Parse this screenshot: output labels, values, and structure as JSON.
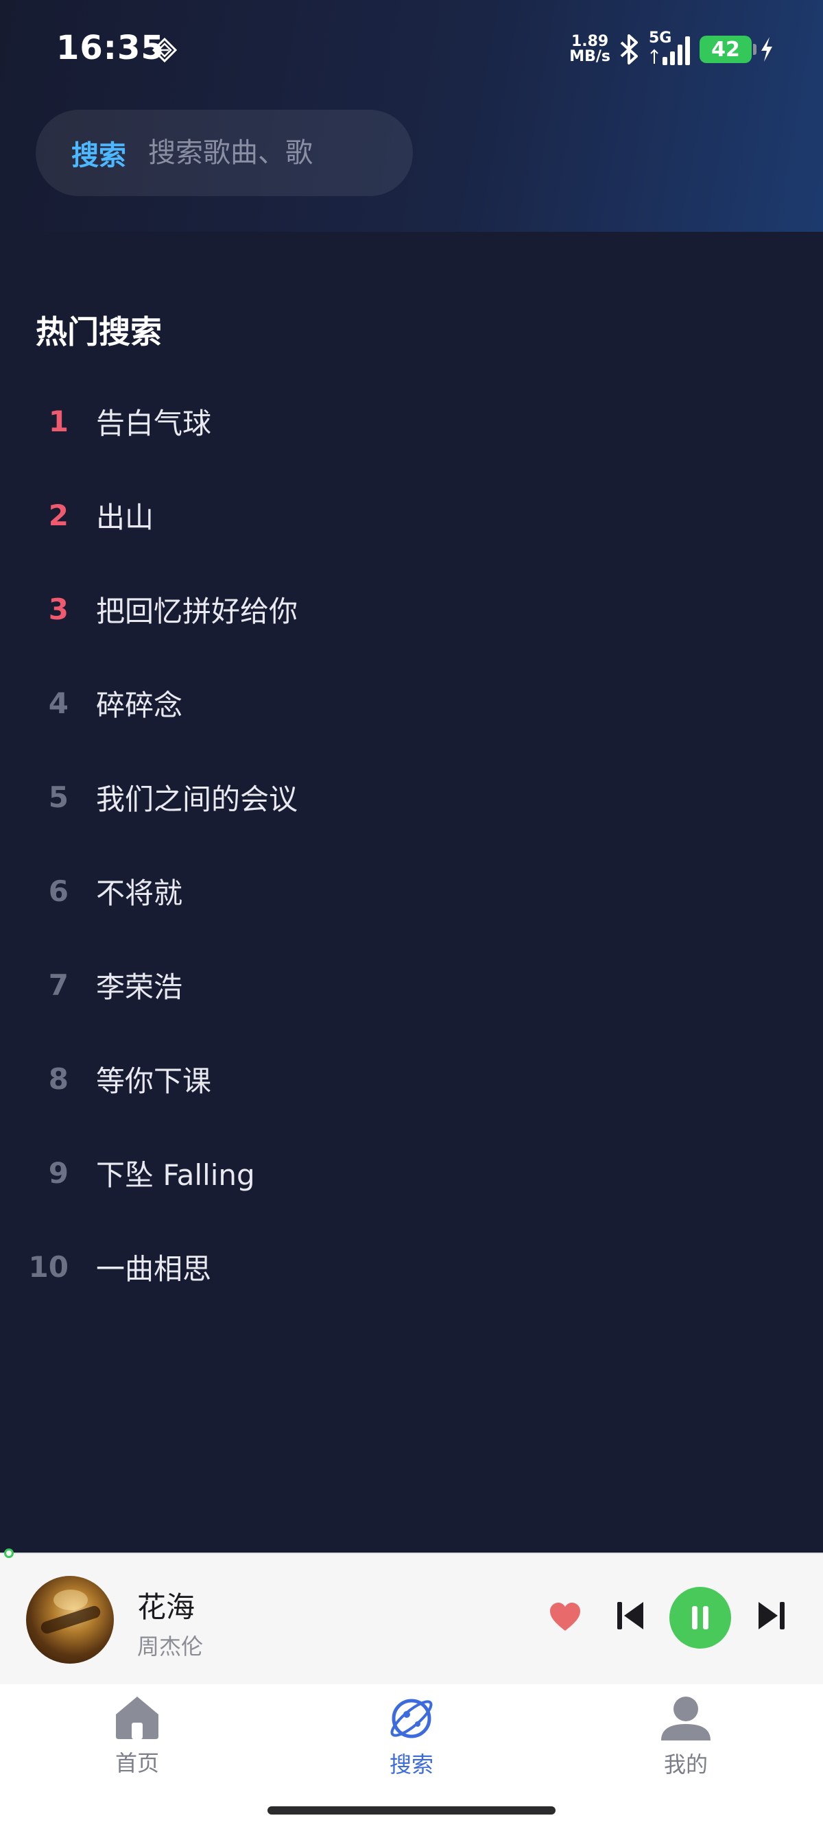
{
  "status_bar": {
    "time": "16:35",
    "net_speed_value": "1.89",
    "net_speed_unit": "MB/s",
    "network": "5G",
    "battery": "42",
    "icons": [
      "diamond-icon",
      "bluetooth-icon",
      "signal-icon",
      "battery-icon",
      "charging-icon"
    ]
  },
  "search": {
    "label": "搜索",
    "placeholder": "搜索歌曲、歌"
  },
  "hot_search": {
    "title": "热门搜索",
    "items": [
      {
        "rank": "1",
        "title": "告白气球"
      },
      {
        "rank": "2",
        "title": "出山"
      },
      {
        "rank": "3",
        "title": "把回忆拼好给你"
      },
      {
        "rank": "4",
        "title": "碎碎念"
      },
      {
        "rank": "5",
        "title": "我们之间的会议"
      },
      {
        "rank": "6",
        "title": "不将就"
      },
      {
        "rank": "7",
        "title": "李荣浩"
      },
      {
        "rank": "8",
        "title": "等你下课"
      },
      {
        "rank": "9",
        "title": "下坠 Falling"
      },
      {
        "rank": "10",
        "title": "一曲相思"
      }
    ]
  },
  "player": {
    "song": "花海",
    "artist": "周杰伦",
    "liked": true,
    "state": "playing",
    "icons": [
      "heart-icon",
      "previous-icon",
      "pause-icon",
      "next-icon"
    ]
  },
  "tabs": [
    {
      "label": "首页",
      "icon": "home-icon",
      "active": false
    },
    {
      "label": "搜索",
      "icon": "planet-icon",
      "active": true
    },
    {
      "label": "我的",
      "icon": "user-icon",
      "active": false
    }
  ],
  "colors": {
    "accent_blue": "#4db8ff",
    "tab_active": "#3c6be0",
    "top_rank": "#f05a6e",
    "play_green": "#48c95a",
    "heart_red": "#e86a6a"
  }
}
